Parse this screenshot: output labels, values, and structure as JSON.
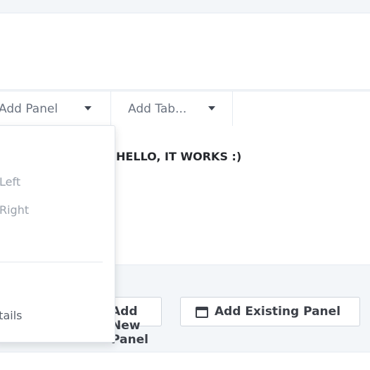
{
  "tab_bar": {
    "tabs": [
      {
        "label": "Add Panel"
      },
      {
        "label": "Add Tab..."
      }
    ]
  },
  "content": {
    "message": "HELLO, IT WORKS :)"
  },
  "actions": {
    "add_new_panel_label": "Add New Panel",
    "add_existing_panel_label": "Add Existing Panel"
  },
  "dropdown": {
    "items": [
      {
        "label": "Move Left"
      },
      {
        "label": "Move Right"
      },
      {
        "label": "Details"
      }
    ]
  },
  "colors": {
    "page_background": "#f3f6f9",
    "panel_background": "#ffffff",
    "border": "#e6ebf1",
    "text_dark": "#25282d",
    "text_muted": "#9aa1ab"
  },
  "icons": {
    "tab_caret": "caret-down-icon",
    "existing_panel": "window-icon"
  }
}
